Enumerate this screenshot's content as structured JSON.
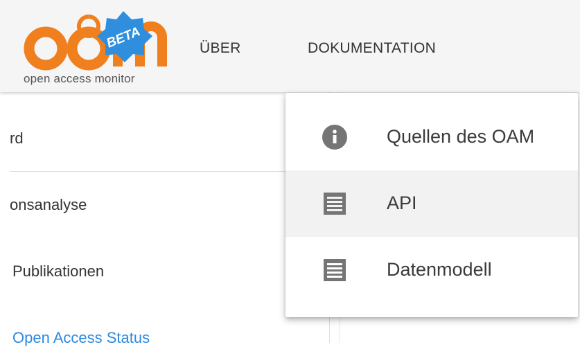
{
  "header": {
    "logo_text": "open access monitor",
    "logo_badge": "BETA",
    "logo_letters": "oam",
    "nav": [
      {
        "label": "ÜBER"
      },
      {
        "label": "DOKUMENTATION"
      }
    ]
  },
  "sidebar": {
    "items": [
      {
        "label": "rd"
      },
      {
        "label": "onsanalyse"
      },
      {
        "label": "Publikationen"
      },
      {
        "label": "Open Access Status"
      }
    ]
  },
  "menu": {
    "items": [
      {
        "label": "Quellen des OAM",
        "icon": "info-icon"
      },
      {
        "label": "API",
        "icon": "document-icon"
      },
      {
        "label": "Datenmodell",
        "icon": "document-icon"
      }
    ]
  },
  "colors": {
    "brand_orange": "#f07f1e",
    "beta_blue": "#2f8fde",
    "link_blue": "#2d8ae0",
    "icon_gray": "#757575"
  }
}
